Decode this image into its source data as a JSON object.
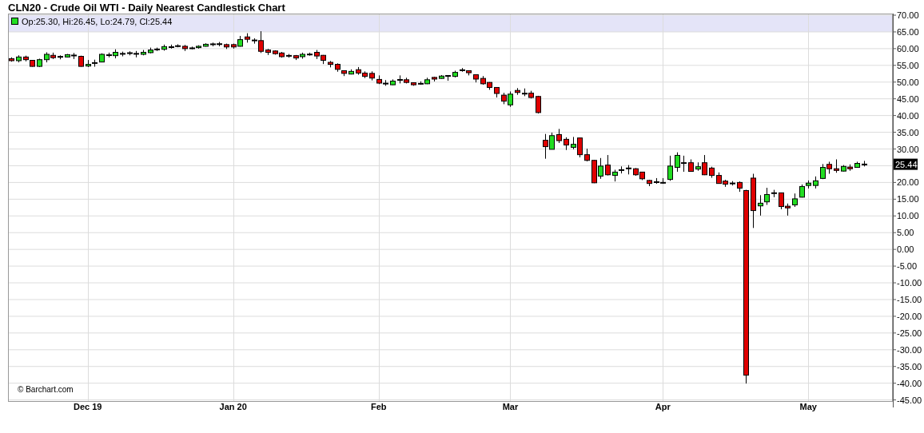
{
  "chart": {
    "legend": "Op:25.30, Hi:26.45, Lo:24.79, Cl:25.44",
    "last_price": "25.44",
    "credit": "© Barchart.com",
    "chart_data": {
      "type": "candlestick",
      "title": "CLN20 - Crude Oil WTI - Daily Nearest Candlestick Chart",
      "grid": true,
      "categories": [
        null,
        null,
        null,
        null,
        null,
        null,
        null,
        null,
        null,
        null,
        null,
        "Dec 19",
        null,
        null,
        null,
        null,
        null,
        null,
        null,
        null,
        null,
        null,
        null,
        null,
        null,
        null,
        null,
        null,
        null,
        null,
        null,
        null,
        "Jan 20",
        null,
        null,
        null,
        null,
        null,
        null,
        null,
        null,
        null,
        null,
        null,
        null,
        null,
        null,
        null,
        null,
        null,
        null,
        null,
        null,
        "Feb",
        null,
        null,
        null,
        null,
        null,
        null,
        null,
        null,
        null,
        null,
        null,
        null,
        null,
        null,
        null,
        null,
        null,
        null,
        "Mar",
        null,
        null,
        null,
        null,
        null,
        null,
        null,
        null,
        null,
        null,
        null,
        null,
        null,
        null,
        null,
        null,
        null,
        null,
        null,
        null,
        null,
        "Apr",
        null,
        null,
        null,
        null,
        null,
        null,
        null,
        null,
        null,
        null,
        null,
        null,
        null,
        null,
        null,
        null,
        null,
        null,
        null,
        null,
        "May",
        null,
        null,
        null,
        null,
        null,
        null,
        null,
        null
      ],
      "ylim": [
        -45,
        70
      ],
      "yticks": [
        {
          "value": 70,
          "label": "70.00"
        },
        {
          "value": 65,
          "label": "65.00"
        },
        {
          "value": 60,
          "label": "60.00"
        },
        {
          "value": 55,
          "label": "55.00"
        },
        {
          "value": 50,
          "label": "50.00"
        },
        {
          "value": 45,
          "label": "45.00"
        },
        {
          "value": 40,
          "label": "40.00"
        },
        {
          "value": 35,
          "label": "35.00"
        },
        {
          "value": 30,
          "label": "30.00"
        },
        {
          "value": 20,
          "label": "20.00"
        },
        {
          "value": 15,
          "label": "15.00"
        },
        {
          "value": 10,
          "label": "10.00"
        },
        {
          "value": 5,
          "label": "5.00"
        },
        {
          "value": 0,
          "label": "0.00"
        },
        {
          "value": -5,
          "label": "-5.00"
        },
        {
          "value": -10,
          "label": "-10.00"
        },
        {
          "value": -15,
          "label": "-15.00"
        },
        {
          "value": -20,
          "label": "-20.00"
        },
        {
          "value": -25,
          "label": "-25.00"
        },
        {
          "value": -30,
          "label": "-30.00"
        },
        {
          "value": -35,
          "label": "-35.00"
        },
        {
          "value": -40,
          "label": "-40.00"
        },
        {
          "value": -45,
          "label": "-45.00"
        }
      ],
      "ohlc": [
        [
          57.0,
          57.4,
          56.1,
          56.4
        ],
        [
          56.4,
          58.0,
          55.9,
          57.5
        ],
        [
          57.5,
          57.9,
          56.2,
          56.7
        ],
        [
          56.5,
          56.6,
          54.6,
          54.7
        ],
        [
          54.7,
          57.0,
          54.5,
          56.7
        ],
        [
          56.7,
          58.9,
          55.9,
          58.3
        ],
        [
          58.0,
          58.8,
          56.9,
          57.3
        ],
        [
          57.6,
          58.0,
          56.8,
          57.5
        ],
        [
          57.5,
          58.4,
          57.4,
          58.2
        ],
        [
          58.0,
          58.7,
          56.9,
          57.9
        ],
        [
          57.7,
          57.9,
          54.6,
          54.7
        ],
        [
          54.8,
          56.6,
          54.5,
          55.3
        ],
        [
          55.6,
          56.7,
          54.6,
          55.8
        ],
        [
          56.0,
          58.6,
          55.9,
          58.3
        ],
        [
          58.0,
          58.8,
          57.4,
          58.1
        ],
        [
          57.9,
          59.8,
          57.1,
          58.9
        ],
        [
          58.4,
          59.1,
          57.7,
          58.5
        ],
        [
          58.6,
          59.2,
          58.0,
          58.7
        ],
        [
          58.5,
          59.3,
          57.4,
          58.4
        ],
        [
          58.3,
          59.6,
          58.0,
          58.9
        ],
        [
          58.8,
          60.3,
          58.6,
          59.6
        ],
        [
          59.7,
          60.3,
          59.3,
          59.8
        ],
        [
          59.8,
          61.2,
          59.4,
          60.6
        ],
        [
          60.3,
          61.2,
          60.0,
          60.6
        ],
        [
          60.7,
          61.3,
          60.4,
          60.8
        ],
        [
          60.7,
          61.1,
          59.3,
          60.0
        ],
        [
          60.1,
          60.6,
          59.8,
          60.1
        ],
        [
          60.3,
          61.0,
          60.0,
          60.7
        ],
        [
          60.7,
          61.6,
          60.6,
          61.3
        ],
        [
          61.3,
          61.8,
          60.7,
          61.3
        ],
        [
          61.3,
          62.0,
          60.7,
          61.4
        ],
        [
          61.2,
          61.5,
          59.9,
          60.5
        ],
        [
          61.2,
          61.5,
          60.0,
          60.5
        ],
        [
          60.7,
          63.8,
          60.6,
          62.7
        ],
        [
          63.5,
          64.6,
          61.8,
          62.8
        ],
        [
          62.5,
          63.1,
          61.5,
          62.4
        ],
        [
          62.4,
          65.2,
          58.7,
          59.2
        ],
        [
          59.6,
          59.9,
          58.1,
          58.9
        ],
        [
          59.3,
          59.5,
          58.2,
          58.5
        ],
        [
          58.7,
          59.0,
          57.3,
          57.6
        ],
        [
          57.9,
          58.4,
          57.3,
          57.8
        ],
        [
          57.9,
          58.1,
          56.6,
          57.2
        ],
        [
          57.6,
          58.8,
          57.0,
          58.3
        ],
        [
          58.2,
          58.8,
          57.9,
          58.3
        ],
        [
          58.9,
          59.6,
          56.9,
          57.8
        ],
        [
          58.0,
          58.1,
          55.4,
          56.5
        ],
        [
          55.9,
          56.3,
          54.4,
          55.3
        ],
        [
          55.3,
          55.6,
          53.1,
          53.8
        ],
        [
          53.4,
          53.5,
          51.8,
          52.6
        ],
        [
          52.4,
          53.8,
          52.3,
          53.2
        ],
        [
          53.7,
          54.5,
          52.2,
          52.7
        ],
        [
          52.7,
          53.2,
          51.2,
          51.7
        ],
        [
          52.6,
          53.2,
          50.5,
          51.2
        ],
        [
          50.8,
          52.0,
          49.4,
          49.7
        ],
        [
          49.6,
          50.6,
          48.9,
          49.5
        ],
        [
          49.2,
          50.8,
          49.1,
          50.3
        ],
        [
          50.6,
          52.0,
          49.6,
          50.7
        ],
        [
          50.7,
          51.3,
          49.6,
          49.9
        ],
        [
          49.8,
          49.9,
          48.9,
          49.2
        ],
        [
          49.5,
          50.2,
          49.2,
          49.5
        ],
        [
          49.5,
          51.3,
          49.4,
          50.7
        ],
        [
          51.4,
          51.6,
          50.2,
          50.9
        ],
        [
          51.1,
          52.1,
          51.0,
          51.8
        ],
        [
          51.8,
          52.1,
          50.4,
          51.9
        ],
        [
          51.7,
          53.4,
          51.4,
          52.9
        ],
        [
          53.5,
          54.2,
          53.1,
          53.6
        ],
        [
          53.4,
          53.5,
          52.0,
          52.8
        ],
        [
          52.2,
          52.2,
          49.9,
          50.9
        ],
        [
          51.1,
          51.8,
          49.2,
          49.5
        ],
        [
          49.9,
          50.0,
          47.7,
          48.4
        ],
        [
          48.4,
          48.4,
          45.4,
          46.6
        ],
        [
          46.1,
          46.8,
          43.4,
          44.3
        ],
        [
          43.2,
          47.2,
          42.6,
          46.4
        ],
        [
          47.5,
          48.2,
          46.2,
          46.9
        ],
        [
          46.6,
          48.1,
          45.8,
          46.5
        ],
        [
          46.7,
          47.4,
          45.1,
          45.4
        ],
        [
          45.7,
          45.9,
          40.6,
          40.9
        ],
        [
          32.6,
          34.5,
          27.1,
          30.7
        ],
        [
          29.9,
          34.9,
          29.9,
          34.0
        ],
        [
          34.3,
          36.0,
          31.8,
          32.5
        ],
        [
          32.9,
          33.5,
          29.7,
          31.2
        ],
        [
          30.5,
          33.6,
          29.9,
          31.4
        ],
        [
          33.3,
          33.3,
          27.5,
          28.3
        ],
        [
          28.3,
          30.1,
          26.3,
          26.6
        ],
        [
          26.6,
          26.7,
          19.8,
          19.9
        ],
        [
          21.9,
          27.3,
          21.1,
          24.9
        ],
        [
          25.2,
          28.2,
          22.1,
          22.3
        ],
        [
          22.1,
          23.8,
          20.3,
          23.1
        ],
        [
          23.7,
          24.8,
          22.7,
          23.7
        ],
        [
          24.2,
          25.2,
          22.4,
          24.2
        ],
        [
          24.1,
          24.3,
          22.0,
          22.3
        ],
        [
          23.1,
          23.1,
          20.7,
          21.1
        ],
        [
          20.6,
          20.8,
          18.9,
          19.7
        ],
        [
          20.1,
          21.3,
          19.6,
          20.1
        ],
        [
          19.9,
          21.3,
          19.6,
          19.9
        ],
        [
          20.9,
          28.0,
          20.5,
          24.9
        ],
        [
          24.5,
          29.0,
          23.2,
          28.1
        ],
        [
          25.8,
          28.0,
          23.2,
          25.8
        ],
        [
          25.9,
          26.9,
          23.3,
          23.3
        ],
        [
          24.0,
          26.0,
          23.5,
          24.7
        ],
        [
          25.9,
          28.2,
          22.2,
          22.3
        ],
        [
          24.3,
          24.7,
          21.4,
          22.1
        ],
        [
          22.1,
          23.0,
          19.7,
          19.7
        ],
        [
          20.4,
          20.8,
          18.7,
          19.5
        ],
        [
          19.7,
          20.4,
          19.1,
          19.7
        ],
        [
          20.0,
          20.3,
          17.2,
          18.3
        ],
        [
          17.6,
          17.8,
          -40.1,
          -37.6
        ],
        [
          21.3,
          22.6,
          6.4,
          11.6
        ],
        [
          13.0,
          16.2,
          10.1,
          13.8
        ],
        [
          14.2,
          18.4,
          13.3,
          16.4
        ],
        [
          16.8,
          17.8,
          15.6,
          16.8
        ],
        [
          16.9,
          16.9,
          12.0,
          12.8
        ],
        [
          12.9,
          13.7,
          10.1,
          12.4
        ],
        [
          13.3,
          16.7,
          12.7,
          15.1
        ],
        [
          15.6,
          19.4,
          15.5,
          18.8
        ],
        [
          19.1,
          20.6,
          18.2,
          19.8
        ],
        [
          19.1,
          21.8,
          18.2,
          20.5
        ],
        [
          21.2,
          25.5,
          21.0,
          24.5
        ],
        [
          25.4,
          26.2,
          22.6,
          24.1
        ],
        [
          24.1,
          26.9,
          22.9,
          23.6
        ],
        [
          23.4,
          25.2,
          23.3,
          24.8
        ],
        [
          24.6,
          25.4,
          23.5,
          24.1
        ],
        [
          24.5,
          26.2,
          24.4,
          25.7
        ],
        [
          25.3,
          26.45,
          24.79,
          25.44
        ]
      ]
    }
  }
}
